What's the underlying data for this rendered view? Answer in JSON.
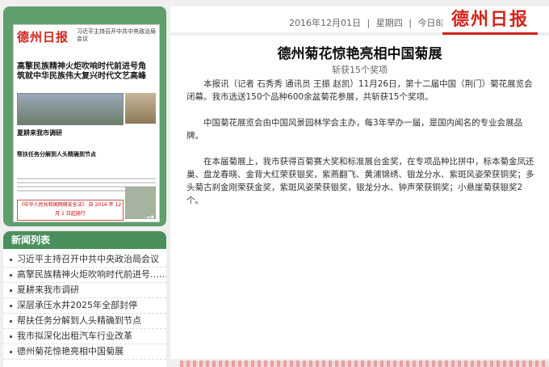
{
  "paper": {
    "thumb_logo": "德州日报",
    "thumb_head1": "习近平主持召开中共中央政治局会议",
    "thumb_headline": "高擎民族精神火炬吹响时代前进号角 筑就中华民族伟大复兴时代文艺高峰",
    "thumb_h2": "夏耕来我市调研",
    "thumb_h4": "帮扶任务分解到人头精确到节点",
    "thumb_footer": "《中华人民共和国网络安全法》 自 2016 年 12 月 1 日起施行"
  },
  "news": {
    "header": "新闻列表",
    "items": [
      "习近平主持召开中共中央政治局会议",
      "高擎民族精神火炬吹响时代前进号……",
      "夏耕来我市调研",
      "深层承压水井2025年全部封停",
      "帮扶任务分解到人头精确到节点",
      "我市拟深化出租汽车行业改革",
      "德州菊花惊艳亮相中国菊展"
    ]
  },
  "top": {
    "date": "2016年12月01日",
    "sep1": "|",
    "weekday": "星期四",
    "sep2": "|",
    "edition": "今日8版",
    "masthead": "德州日报"
  },
  "article": {
    "headline": "德州菊花惊艳亮相中国菊展",
    "subhead": "斩获15个奖项",
    "paragraphs": [
      "本报讯（记者 石秀秀 通讯员 王振 赵凯）11月26日，第十二届中国（荆门）菊花展览会闭幕。我市选送150个品种600余盆菊花参展，共斩获15个奖项。",
      "中国菊花展览会由中国风景园林学会主办，每3年举办一届，是国内闻名的专业会展品牌。",
      "在本届菊展上，我市获得百菊赛大奖和标准展台金奖，在专项品种比拼中，标本菊金凤还巢、盘龙春晓、金背大红荣获银奖，紫燕翻飞、黄浦锦绣、银龙分水、紫斑风姿荣获铜奖；多头菊古刹金刚荣获金奖，紫斑风姿荣获银奖，银龙分水、钟声荣获铜奖；小悬崖菊获银奖2个。"
    ]
  },
  "colors": {
    "panel_green": "#5f9e6d",
    "header_green": "#4a8f5c",
    "brand_red": "#d0241c"
  }
}
